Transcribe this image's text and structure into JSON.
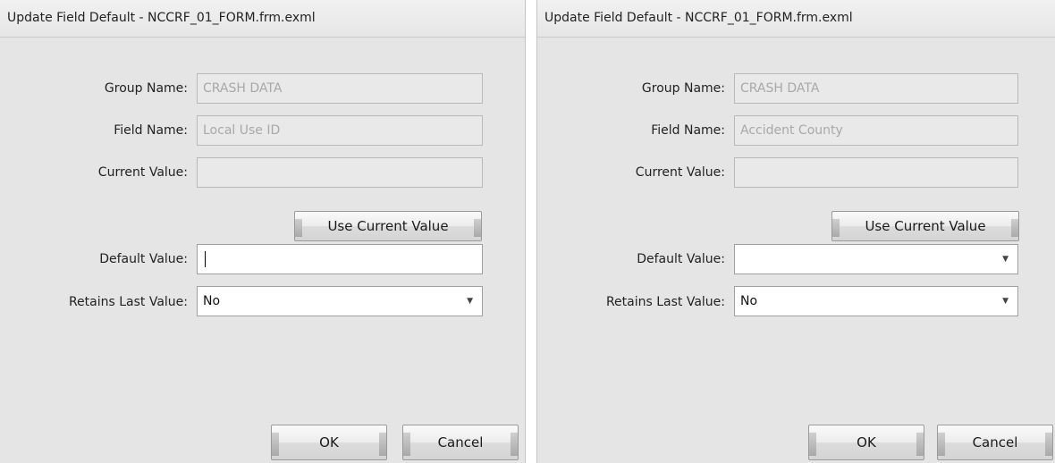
{
  "dialogs": [
    {
      "title": "Update Field Default - NCCRF_01_FORM.frm.exml",
      "labels": {
        "group_name": "Group Name:",
        "field_name": "Field Name:",
        "current_value": "Current Value:",
        "default_value": "Default Value:",
        "retains_last_value": "Retains Last Value:"
      },
      "group_name_value": "CRASH DATA",
      "field_name_value": "Local Use ID",
      "current_value": "",
      "default_value": "",
      "default_value_control": "text-input",
      "retains_last_value": "No",
      "buttons": {
        "use_current": "Use Current Value",
        "ok": "OK",
        "cancel": "Cancel"
      }
    },
    {
      "title": "Update Field Default - NCCRF_01_FORM.frm.exml",
      "labels": {
        "group_name": "Group Name:",
        "field_name": "Field Name:",
        "current_value": "Current Value:",
        "default_value": "Default Value:",
        "retains_last_value": "Retains Last Value:"
      },
      "group_name_value": "CRASH DATA",
      "field_name_value": "Accident County",
      "current_value": "",
      "default_value": "",
      "default_value_control": "dropdown",
      "retains_last_value": "No",
      "buttons": {
        "use_current": "Use Current Value",
        "ok": "OK",
        "cancel": "Cancel"
      }
    }
  ]
}
